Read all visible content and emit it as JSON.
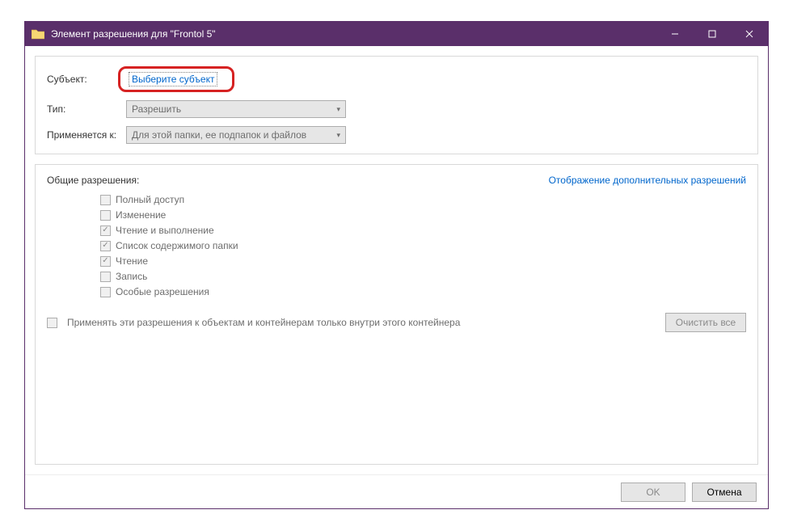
{
  "window": {
    "title": "Элемент разрешения для \"Frontol 5\""
  },
  "form": {
    "subject_label": "Субъект:",
    "subject_link": "Выберите субъект",
    "type_label": "Тип:",
    "type_value": "Разрешить",
    "applies_label": "Применяется к:",
    "applies_value": "Для этой папки, ее подпапок и файлов"
  },
  "permissions": {
    "header": "Общие разрешения:",
    "advanced_link": "Отображение дополнительных разрешений",
    "items": [
      {
        "label": "Полный доступ",
        "checked": false
      },
      {
        "label": "Изменение",
        "checked": false
      },
      {
        "label": "Чтение и выполнение",
        "checked": true
      },
      {
        "label": "Список содержимого папки",
        "checked": true
      },
      {
        "label": "Чтение",
        "checked": true
      },
      {
        "label": "Запись",
        "checked": false
      },
      {
        "label": "Особые разрешения",
        "checked": false
      }
    ],
    "apply_only": "Применять эти разрешения к объектам и контейнерам только внутри этого контейнера",
    "clear_all": "Очистить все"
  },
  "buttons": {
    "ok": "OK",
    "cancel": "Отмена"
  }
}
